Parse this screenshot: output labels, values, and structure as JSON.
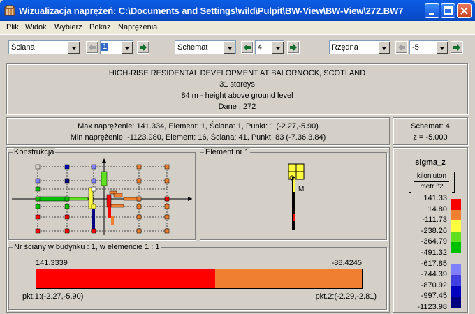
{
  "window": {
    "title": "Wizualizacja naprężeń: C:\\Documents and Settings\\wild\\Pulpit\\BW-View\\BW-View\\272.BW7",
    "icon": "app-icon",
    "controls": [
      "minimize-icon",
      "maximize-icon",
      "close-icon"
    ]
  },
  "menu": [
    "Plik",
    "Widok",
    "Wybierz",
    "Pokaż",
    "Naprężenia"
  ],
  "toolbar": {
    "combo1": "Ściana",
    "spin1": "1",
    "combo2": "Schemat",
    "spin2": "4",
    "combo3": "Rzędna",
    "spin3": "-5"
  },
  "header": {
    "line1": "HIGH-RISE RESIDENTAL DEVELOPMENT AT BALORNOCK, SCOTLAND",
    "line2": "31 storeys",
    "line3": "84 m - height above ground level",
    "line4": "Dane :   272"
  },
  "stats": {
    "max": "Max naprężenie: 141.334,   Element: 1,   Ściana: 1,   Punkt: 1 (-2.27,-5.90)",
    "min": "Min naprężenie: -1123.980,   Element: 16,   Ściana: 41,   Punkt: 83 (-7.36,3.84)"
  },
  "schemat": {
    "line1": "Schemat: 4",
    "line2": "z = -5.000"
  },
  "groups": {
    "konstrukcja": "Konstrukcja",
    "element": "Element nr 1",
    "element_marker": "M",
    "nr_sciany": "Nr ściany w budynku :  1,   w elemencie 1 :  1"
  },
  "bar": {
    "left_value": "141.3339",
    "right_value": "-88.4245",
    "left_point": "pkt.1:(-2.27,-5.90)",
    "right_point": "pkt.2:(-2.29,-2.81)",
    "split_fraction": 0.55,
    "color_left": "#ff0000",
    "color_right": "#f08030"
  },
  "legend": {
    "title": "sigma_z",
    "unit_top": "kiloniuton",
    "unit_bottom": "metr ^2",
    "values": [
      "141.33",
      "14.80",
      "-111.73",
      "-238.26",
      "-364.79",
      "-491.32",
      "-617.85",
      "-744.39",
      "-870.92",
      "-997.45",
      "-1123.98"
    ],
    "colors": [
      "#ff0000",
      "#f08030",
      "#ffff40",
      "#60e020",
      "#00c000",
      "#d4d0c8",
      "#8080ff",
      "#4040e0",
      "#0000c0",
      "#000080"
    ]
  }
}
